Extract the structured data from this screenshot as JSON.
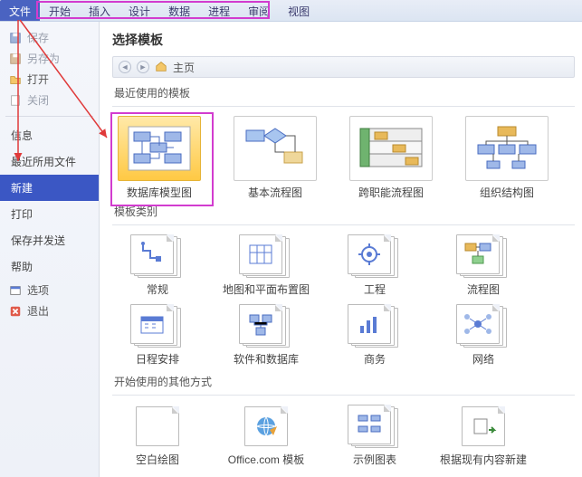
{
  "ribbon": {
    "tabs": [
      "文件",
      "开始",
      "插入",
      "设计",
      "数据",
      "进程",
      "审阅",
      "视图"
    ]
  },
  "backstage": {
    "save": "保存",
    "save_as": "另存为",
    "open": "打开",
    "close": "关闭",
    "info": "信息",
    "recent": "最近所用文件",
    "new": "新建",
    "print": "打印",
    "save_send": "保存并发送",
    "help": "帮助",
    "options": "选项",
    "exit": "退出"
  },
  "content": {
    "title": "选择模板",
    "home": "主页",
    "recent_label": "最近使用的模板",
    "recent_templates": [
      "数据库模型图",
      "基本流程图",
      "跨职能流程图",
      "组织结构图"
    ],
    "cat_label": "模板类别",
    "categories_row1": [
      "常规",
      "地图和平面布置图",
      "工程",
      "流程图"
    ],
    "categories_row2": [
      "日程安排",
      "软件和数据库",
      "商务",
      "网络"
    ],
    "other_label": "开始使用的其他方式",
    "other_row": [
      "空白绘图",
      "Office.com 模板",
      "示例图表",
      "根据现有内容新建"
    ]
  }
}
